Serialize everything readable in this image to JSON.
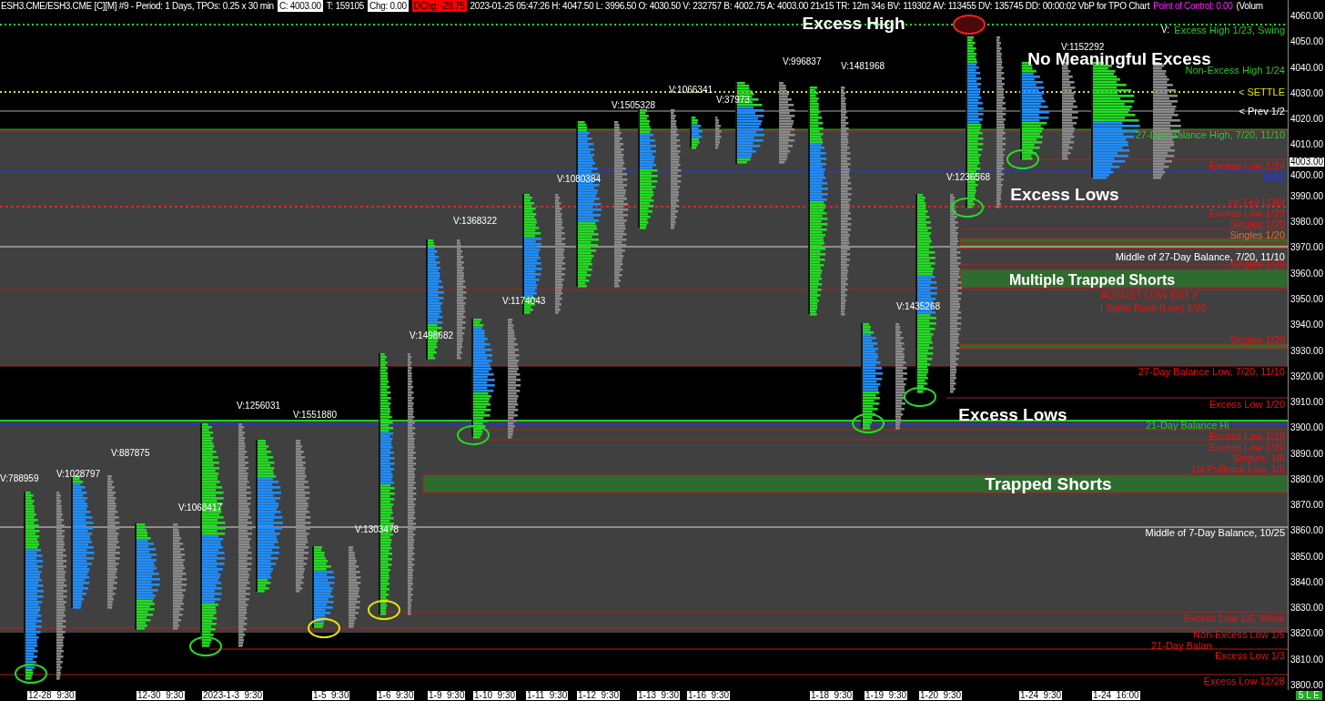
{
  "header": [
    {
      "kind": "plain",
      "text": "ESH3.CME/ESH3.CME [C][M]  #9 - Period: 1 Days, TPOs: 0.25 x 30 min"
    },
    {
      "kind": "boxed",
      "text": "C: 4003.00"
    },
    {
      "kind": "plain",
      "text": "T: 159105"
    },
    {
      "kind": "boxed",
      "text": "Chg: 0.00"
    },
    {
      "kind": "alert",
      "text": "DChg: -29.75"
    },
    {
      "kind": "plain",
      "text": "2023-01-25 05:47:26 H: 4047.50 L: 3996.50 O: 4030.50 V: 232757 B: 4002.75 A: 4003.00 21x15 TR: 12m 34s BV: 119302 AV: 113455 DV: 135745 DD: 00:00:02 VbP for TPO Chart"
    },
    {
      "kind": "poc",
      "text": "Point of Control: 0.00"
    },
    {
      "kind": "plain",
      "text": "(Volum"
    }
  ],
  "annotations": [
    "Excess High",
    "No Meaningful Excess",
    "Excess Lows",
    "Multiple Trapped Shorts",
    "Excess Lows",
    "Trapped Shorts"
  ],
  "volume_labels": [
    "V:788959",
    "V:1028797",
    "V:887875",
    "V:1068417",
    "V:1256031",
    "V:1551880",
    "V:1303478",
    "V:1498682",
    "V:1368322",
    "V:1174043",
    "V:1080384",
    "V:1505328",
    "V:1066341",
    "V:37973",
    "V:996837",
    "V:1481968",
    "V:1236568",
    "V:1435268",
    "V:1152292",
    "V:"
  ],
  "level_labels": [
    {
      "text": "Excess High 1/23, Swing",
      "color": "#22cc22"
    },
    {
      "text": "Non-Excess High 1/24",
      "color": "#22cc22"
    },
    {
      "text": "< SETTLE",
      "color": "#e6e600"
    },
    {
      "text": "< Prev 1/2",
      "color": "#ffffff"
    },
    {
      "text": "27-Day Balance High, 7/20, 11/10",
      "color": "#22cc22"
    },
    {
      "text": "Excess Low 1/24",
      "color": "#ee1111"
    },
    {
      "text": "4000",
      "color": "#2233ff"
    },
    {
      "text": "<< T+2 LOW",
      "color": "#ee1111"
    },
    {
      "text": "Excess Low 1/23",
      "color": "#ee1111"
    },
    {
      "text": "Singles 1/20",
      "color": "#ee1111"
    },
    {
      "text": "Singles 1/20",
      "color": "#e0702a"
    },
    {
      "text": "Middle of 27-Day Balance, 7/20, 11/10",
      "color": "#ffffff"
    },
    {
      "text": "Singles 1/20",
      "color": "#ee1111"
    },
    {
      "text": "AUGUST LOW 8/31 //",
      "color": "#ee1111"
    },
    {
      "text": "I Spike Base (Low) 1/20",
      "color": "#ee1111"
    },
    {
      "text": "Singles 1/20",
      "color": "#ee1111"
    },
    {
      "text": "27-Day Balance Low, 7/20, 11/10",
      "color": "#ee1111"
    },
    {
      "text": "Excess Low 1/20",
      "color": "#ee1111"
    },
    {
      "text": "21-Day Balance Hi",
      "color": "#22cc22"
    },
    {
      "text": "Excess Low 1/19",
      "color": "#ee1111"
    },
    {
      "text": "Excess Low 1/10",
      "color": "#ee1111"
    },
    {
      "text": "Singles, 1/6",
      "color": "#ee1111"
    },
    {
      "text": "1st Pullback Low, 1/6",
      "color": "#ee1111"
    },
    {
      "text": "Middle of 7-Day Balance, 10/25",
      "color": "#ffffff"
    },
    {
      "text": "Excess Low 1/6, Weak",
      "color": "#ee1111"
    },
    {
      "text": "Non-Excess Low 1/5",
      "color": "#ee1111"
    },
    {
      "text": "21-Day Balan",
      "color": "#ee1111"
    },
    {
      "text": "Excess Low 1/3",
      "color": "#ee1111"
    },
    {
      "text": "Excess Low 12/28",
      "color": "#ee1111"
    }
  ],
  "price_axis": {
    "ticks": [
      "4060.00",
      "4050.00",
      "4040.00",
      "4030.00",
      "4020.00",
      "4010.00",
      "4000.00",
      "3990.00",
      "3980.00",
      "3970.00",
      "3960.00",
      "3950.00",
      "3940.00",
      "3930.00",
      "3920.00",
      "3910.00",
      "3900.00",
      "3890.00",
      "3880.00",
      "3870.00",
      "3860.00",
      "3850.00",
      "3840.00",
      "3830.00",
      "3820.00",
      "3810.00",
      "3800.00"
    ],
    "current_price": "4003.00"
  },
  "time_axis": [
    "12-28  9:30",
    "12-30  9:30",
    "2023-1-3  9:30",
    "1-5  9:30",
    "1-6  9:30",
    "1-9  9:30",
    "1-10  9:30",
    "1-11  9:30",
    "1-12  9:30",
    "1-13  9:30",
    "1-16  9:30",
    "1-18  9:30",
    "1-19  9:30",
    "1-20  9:30",
    "1-24  9:30",
    "1-24  16:00"
  ],
  "status_badge": "5 L E"
}
